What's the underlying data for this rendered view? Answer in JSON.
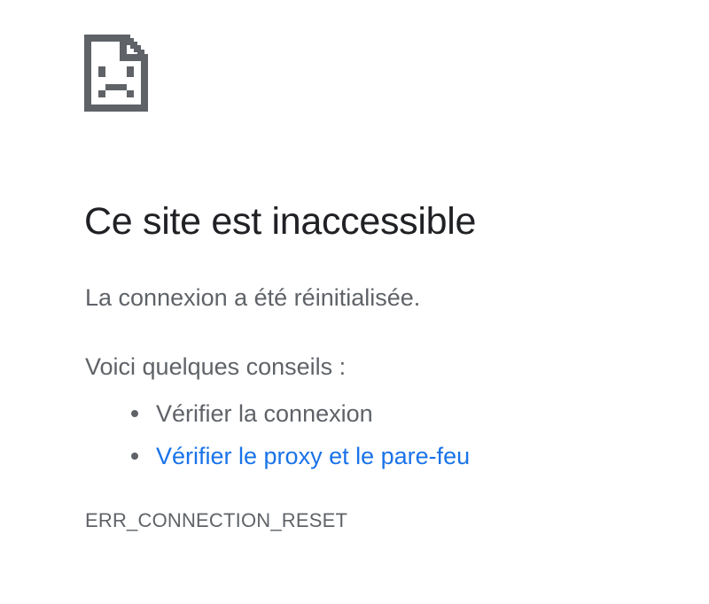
{
  "error_page": {
    "icon": "sad-page-icon",
    "title": "Ce site est inaccessible",
    "subtitle": "La connexion a été réinitialisée.",
    "tips_heading": "Voici quelques conseils :",
    "tips": [
      {
        "label": "Vérifier la connexion",
        "is_link": false
      },
      {
        "label": "Vérifier le proxy et le pare-feu",
        "is_link": true
      }
    ],
    "error_code": "ERR_CONNECTION_RESET"
  },
  "colors": {
    "title": "#202124",
    "body_text": "#5f6368",
    "link": "#1a73e8",
    "icon": "#5f6368",
    "background": "#ffffff"
  }
}
